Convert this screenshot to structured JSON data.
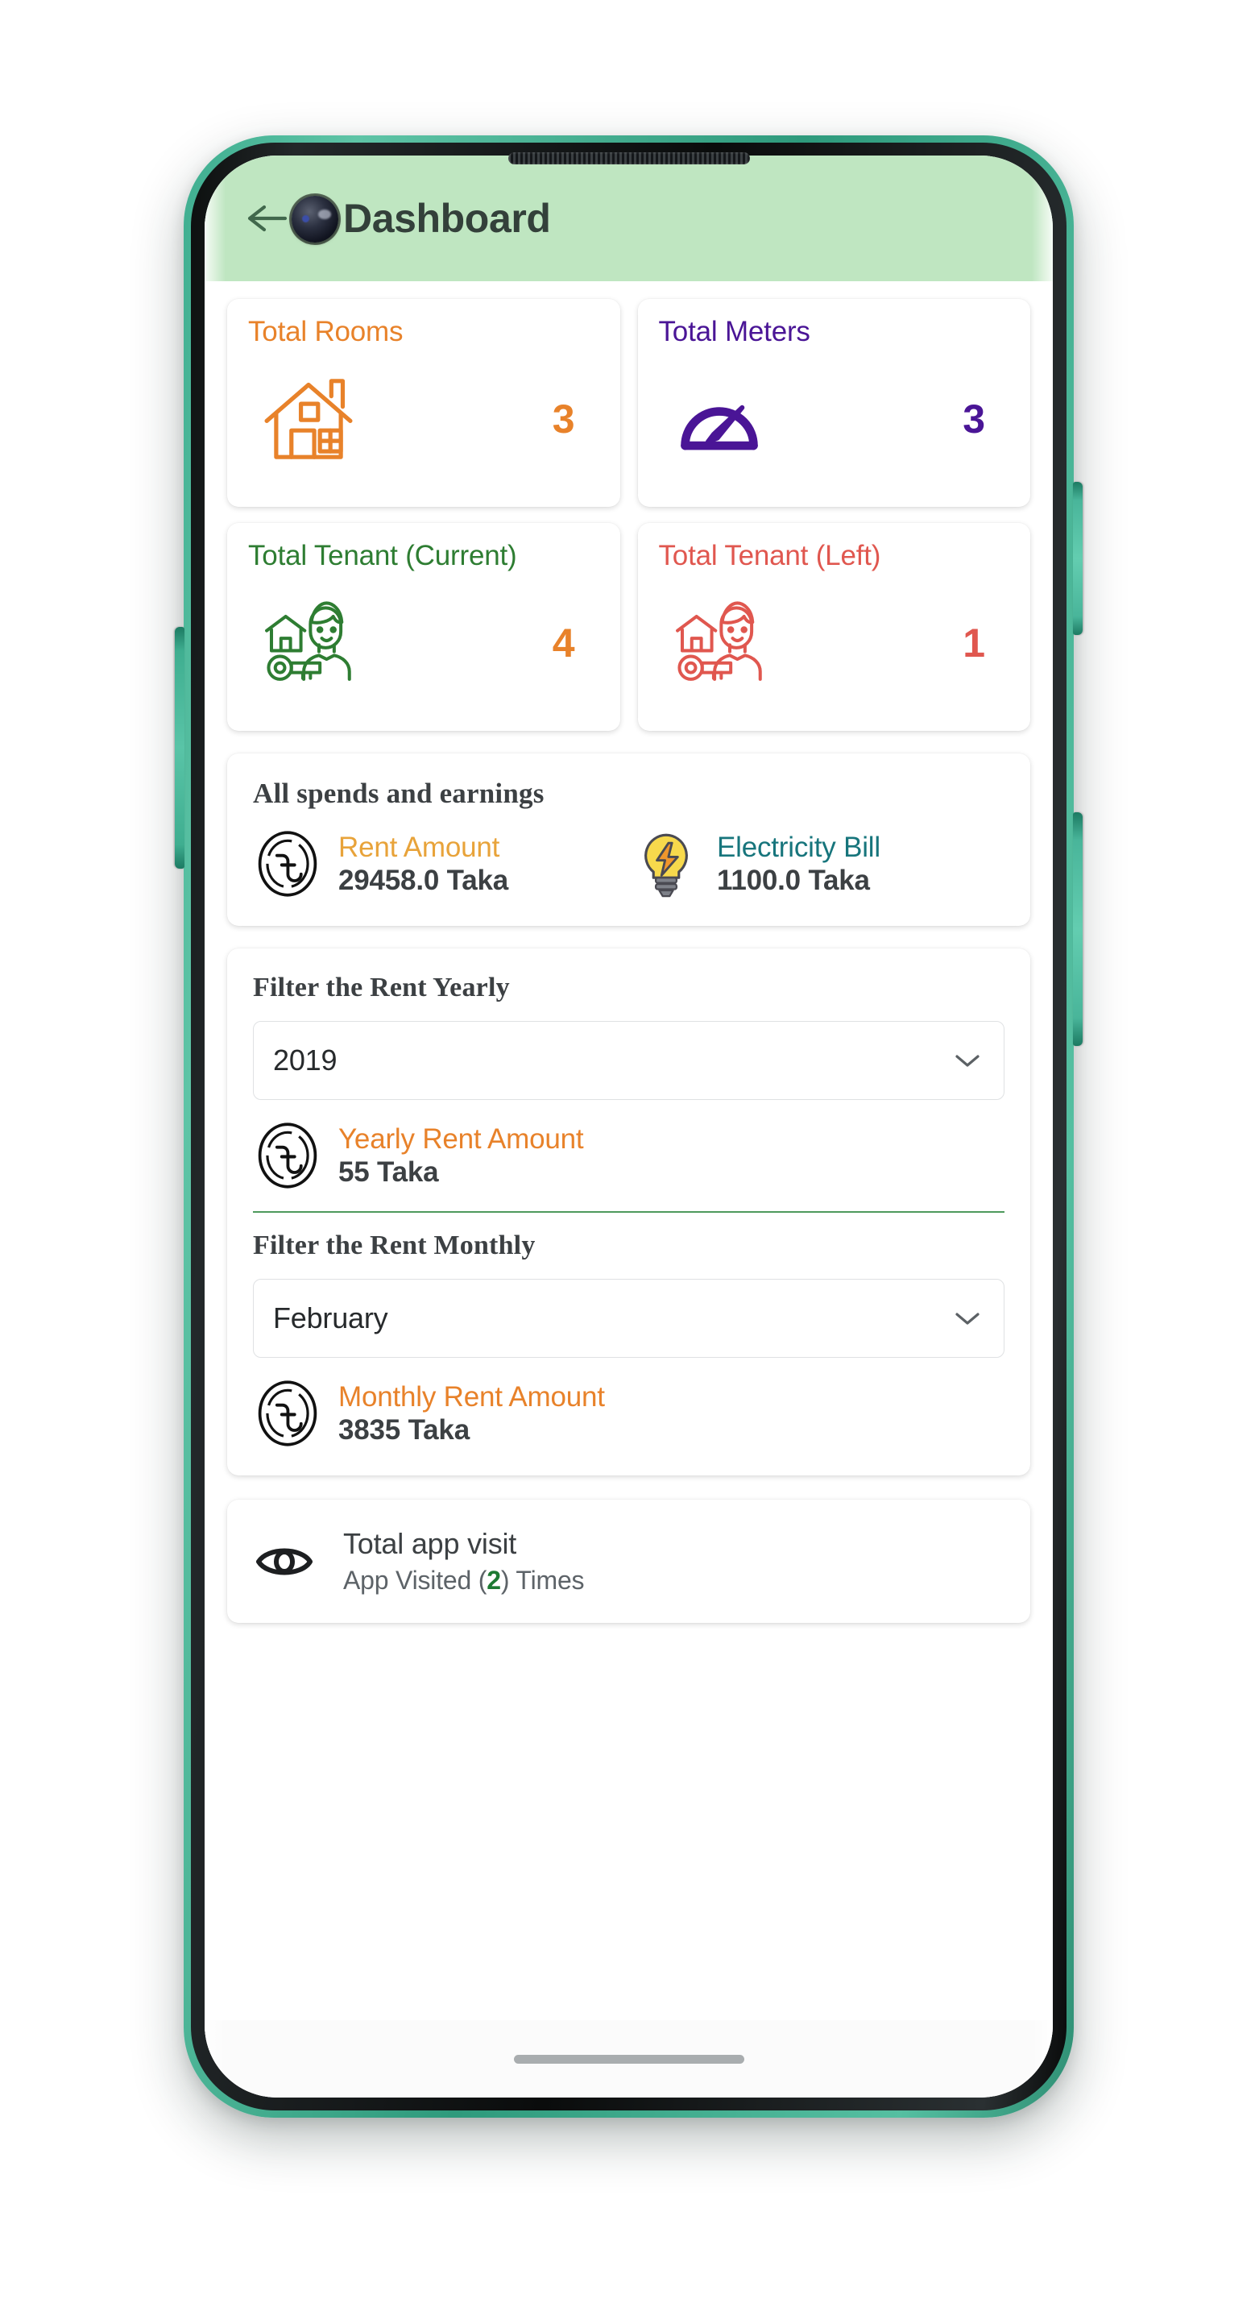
{
  "appbar": {
    "title": "Dashboard",
    "back_icon": "arrow-left-icon",
    "bg_color": "#bfe6c1"
  },
  "colors": {
    "orange": "#e8822a",
    "purple": "#4a1596",
    "green": "#2e7d32",
    "red": "#e0574f",
    "teal": "#17757c",
    "dark": "#3c4043",
    "visit_green": "#1d7a32"
  },
  "stats": [
    {
      "title": "Total Rooms",
      "value": "3",
      "icon": "house-icon",
      "color": "#e8822a",
      "value_color": "#e8822a"
    },
    {
      "title": "Total Meters",
      "value": "3",
      "icon": "speedometer-icon",
      "color": "#4a1596",
      "value_color": "#4a1596"
    },
    {
      "title": "Total Tenant (Current)",
      "value": "4",
      "icon": "tenant-house-key-icon",
      "color": "#2e7d32",
      "value_color": "#e8822a"
    },
    {
      "title": "Total Tenant (Left)",
      "value": "1",
      "icon": "tenant-house-key-icon",
      "color": "#e0574f",
      "value_color": "#e0574f"
    }
  ],
  "spends": {
    "heading": "All spends and earnings",
    "items": [
      {
        "label": "Rent Amount",
        "amount": "29458.0 Taka",
        "icon": "taka-coin-icon",
        "label_color": "#e8a33a"
      },
      {
        "label": "Electricity Bill",
        "amount": "1100.0 Taka",
        "icon": "lightbulb-icon",
        "label_color": "#17757c"
      }
    ]
  },
  "filters": {
    "yearly": {
      "label": "Filter the Rent Yearly",
      "select_value": "2019",
      "select_icon": "chevron-down-icon",
      "amount_label": "Yearly Rent Amount",
      "amount_value": "55 Taka",
      "amount_icon": "taka-coin-icon"
    },
    "monthly": {
      "label": "Filter the Rent Monthly",
      "select_value": "February",
      "select_icon": "chevron-down-icon",
      "amount_label": "Monthly Rent Amount",
      "amount_value": "3835 Taka",
      "amount_icon": "taka-coin-icon"
    }
  },
  "visit": {
    "icon": "eye-icon",
    "title": "Total app visit",
    "sub_prefix": "App Visited (",
    "count": "2",
    "sub_suffix": ") Times"
  }
}
